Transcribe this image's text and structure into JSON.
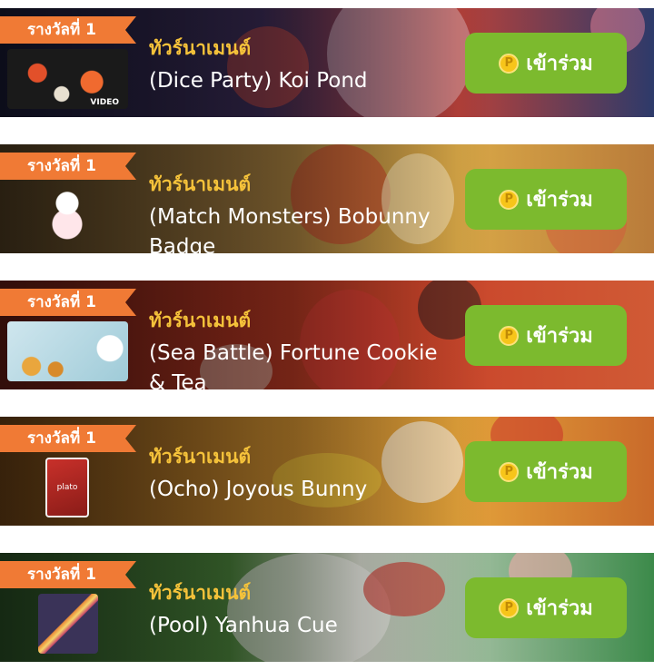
{
  "cards": [
    {
      "badge": "รางวัลที่ 1",
      "title": "ทัวร์นาเมนต์",
      "name": "(Dice Party) Koi Pond",
      "join_label": "เข้าร่วม",
      "coin_icon": "coin-icon",
      "thumb_caption": "VIDEO",
      "bg_color": "#2a2f5a"
    },
    {
      "badge": "รางวัลที่ 1",
      "title": "ทัวร์นาเมนต์",
      "name": "(Match Monsters) Bobunny Badge",
      "join_label": "เข้าร่วม",
      "coin_icon": "coin-icon",
      "bg_color": "#c89a3a"
    },
    {
      "badge": "รางวัลที่ 1",
      "title": "ทัวร์นาเมนต์",
      "name": "(Sea Battle) Fortune Cookie & Tea",
      "join_label": "เข้าร่วม",
      "coin_icon": "coin-icon",
      "bg_color": "#b5301f"
    },
    {
      "badge": "รางวัลที่ 1",
      "title": "ทัวร์นาเมนต์",
      "name": "(Ocho) Joyous Bunny",
      "join_label": "เข้าร่วม",
      "coin_icon": "coin-icon",
      "thumb_caption": "plato",
      "bg_color": "#d68c2a"
    },
    {
      "badge": "รางวัลที่ 1",
      "title": "ทัวร์นาเมนต์",
      "name": "(Pool) Yanhua Cue",
      "join_label": "เข้าร่วม",
      "coin_icon": "coin-icon",
      "bg_color": "#4a9a4a"
    }
  ],
  "colors": {
    "ribbon": "#f07a35",
    "title": "#f5c23a",
    "button": "#7cba2e",
    "coin": "#f7c51a"
  }
}
